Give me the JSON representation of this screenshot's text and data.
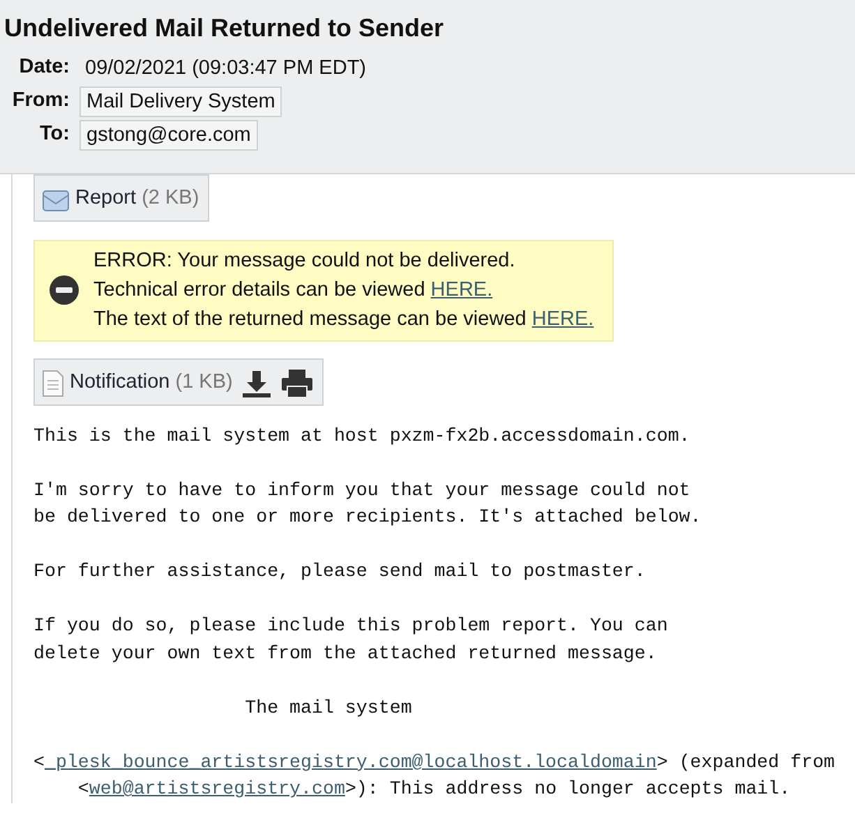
{
  "subject": "Undelivered Mail Returned to Sender",
  "fields": [
    {
      "label": "Date:",
      "value": "09/02/2021 (09:03:47 PM EDT)",
      "boxed": false
    },
    {
      "label": "From:",
      "value": "Mail Delivery System",
      "boxed": true
    },
    {
      "label": "To:",
      "value": "gstong@core.com",
      "boxed": true
    }
  ],
  "attachments_top": [
    {
      "kind": "envelope",
      "name": "Report",
      "size": "(2 KB)"
    }
  ],
  "error_box": {
    "lines": [
      [
        {
          "text": "ERROR: Your message could not be delivered.",
          "link": false
        }
      ],
      [
        {
          "text": "Technical error details can be viewed ",
          "link": false
        },
        {
          "text": "HERE.",
          "link": true
        }
      ],
      [
        {
          "text": "The text of the returned message can be viewed ",
          "link": false
        },
        {
          "text": "HERE.",
          "link": true
        }
      ]
    ]
  },
  "attachments": [
    {
      "kind": "document",
      "name": "Notification",
      "size": "(1 KB)",
      "actions": [
        {
          "kind": "download"
        },
        {
          "kind": "print"
        }
      ]
    }
  ],
  "body": [
    {
      "lines": [
        [
          {
            "text": "This is the mail system at host pxzm-fx2b.accessdomain.com.",
            "link": false
          }
        ]
      ]
    },
    {
      "lines": [
        [
          {
            "text": "I'm sorry to have to inform you that your message could not",
            "link": false
          }
        ],
        [
          {
            "text": "be delivered to one or more recipients. It's attached below.",
            "link": false
          }
        ]
      ]
    },
    {
      "lines": [
        [
          {
            "text": "For further assistance, please send mail to postmaster.",
            "link": false
          }
        ]
      ]
    },
    {
      "lines": [
        [
          {
            "text": "If you do so, please include this problem report. You can",
            "link": false
          }
        ],
        [
          {
            "text": "delete your own text from the attached returned message.",
            "link": false
          }
        ]
      ]
    },
    {
      "lines": [
        [
          {
            "text": "                   The mail system",
            "link": false
          }
        ]
      ]
    },
    {
      "lines": [
        [
          {
            "text": "<",
            "link": false
          },
          {
            "text": "_plesk_bounce_artistsregistry.com@localhost.localdomain",
            "link": true
          },
          {
            "text": "> (expanded from",
            "link": false
          }
        ],
        [
          {
            "text": "    <",
            "link": false
          },
          {
            "text": "web@artistsregistry.com",
            "link": true
          },
          {
            "text": ">): This address no longer accepts mail.",
            "link": false
          }
        ]
      ]
    }
  ]
}
